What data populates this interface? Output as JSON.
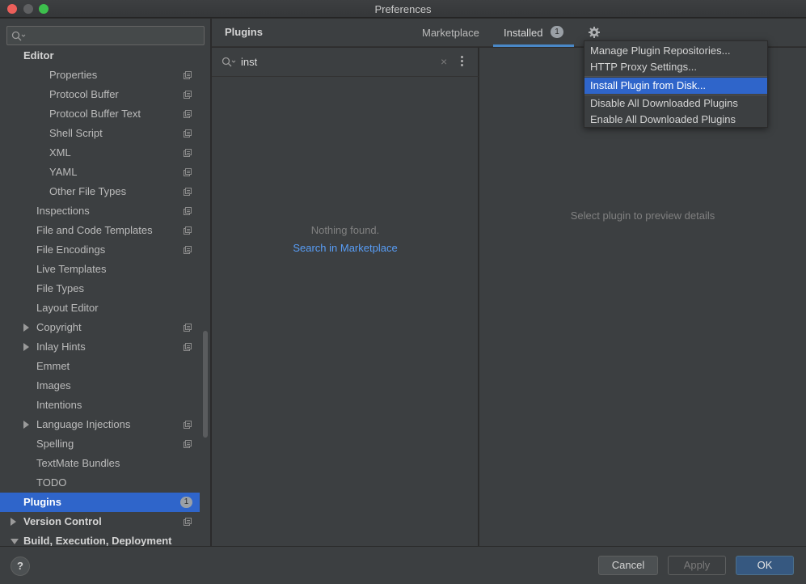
{
  "window": {
    "title": "Preferences"
  },
  "sidebar": {
    "search_placeholder": "",
    "items": [
      {
        "label": "Editor",
        "level": 0,
        "bold": true,
        "arrow": "none",
        "copy_icon": false,
        "badge": ""
      },
      {
        "label": "Properties",
        "level": 2,
        "bold": false,
        "arrow": "none",
        "copy_icon": true,
        "badge": ""
      },
      {
        "label": "Protocol Buffer",
        "level": 2,
        "bold": false,
        "arrow": "none",
        "copy_icon": true,
        "badge": ""
      },
      {
        "label": "Protocol Buffer Text",
        "level": 2,
        "bold": false,
        "arrow": "none",
        "copy_icon": true,
        "badge": ""
      },
      {
        "label": "Shell Script",
        "level": 2,
        "bold": false,
        "arrow": "none",
        "copy_icon": true,
        "badge": ""
      },
      {
        "label": "XML",
        "level": 2,
        "bold": false,
        "arrow": "none",
        "copy_icon": true,
        "badge": ""
      },
      {
        "label": "YAML",
        "level": 2,
        "bold": false,
        "arrow": "none",
        "copy_icon": true,
        "badge": ""
      },
      {
        "label": "Other File Types",
        "level": 2,
        "bold": false,
        "arrow": "none",
        "copy_icon": true,
        "badge": ""
      },
      {
        "label": "Inspections",
        "level": 1,
        "bold": false,
        "arrow": "none",
        "copy_icon": true,
        "badge": ""
      },
      {
        "label": "File and Code Templates",
        "level": 1,
        "bold": false,
        "arrow": "none",
        "copy_icon": true,
        "badge": ""
      },
      {
        "label": "File Encodings",
        "level": 1,
        "bold": false,
        "arrow": "none",
        "copy_icon": true,
        "badge": ""
      },
      {
        "label": "Live Templates",
        "level": 1,
        "bold": false,
        "arrow": "none",
        "copy_icon": false,
        "badge": ""
      },
      {
        "label": "File Types",
        "level": 1,
        "bold": false,
        "arrow": "none",
        "copy_icon": false,
        "badge": ""
      },
      {
        "label": "Layout Editor",
        "level": 1,
        "bold": false,
        "arrow": "none",
        "copy_icon": false,
        "badge": ""
      },
      {
        "label": "Copyright",
        "level": 1,
        "bold": false,
        "arrow": "right",
        "copy_icon": true,
        "badge": ""
      },
      {
        "label": "Inlay Hints",
        "level": 1,
        "bold": false,
        "arrow": "right",
        "copy_icon": true,
        "badge": ""
      },
      {
        "label": "Emmet",
        "level": 1,
        "bold": false,
        "arrow": "none",
        "copy_icon": false,
        "badge": ""
      },
      {
        "label": "Images",
        "level": 1,
        "bold": false,
        "arrow": "none",
        "copy_icon": false,
        "badge": ""
      },
      {
        "label": "Intentions",
        "level": 1,
        "bold": false,
        "arrow": "none",
        "copy_icon": false,
        "badge": ""
      },
      {
        "label": "Language Injections",
        "level": 1,
        "bold": false,
        "arrow": "right",
        "copy_icon": true,
        "badge": ""
      },
      {
        "label": "Spelling",
        "level": 1,
        "bold": false,
        "arrow": "none",
        "copy_icon": true,
        "badge": ""
      },
      {
        "label": "TextMate Bundles",
        "level": 1,
        "bold": false,
        "arrow": "none",
        "copy_icon": false,
        "badge": ""
      },
      {
        "label": "TODO",
        "level": 1,
        "bold": false,
        "arrow": "none",
        "copy_icon": false,
        "badge": ""
      },
      {
        "label": "Plugins",
        "level": 0,
        "bold": true,
        "arrow": "none",
        "copy_icon": false,
        "badge": "1",
        "selected": true
      },
      {
        "label": "Version Control",
        "level": 0,
        "bold": true,
        "arrow": "right",
        "copy_icon": true,
        "badge": ""
      },
      {
        "label": "Build, Execution, Deployment",
        "level": 0,
        "bold": true,
        "arrow": "down",
        "copy_icon": false,
        "badge": ""
      }
    ]
  },
  "header": {
    "title": "Plugins",
    "tabs": {
      "marketplace": "Marketplace",
      "installed": "Installed",
      "installed_badge": "1"
    }
  },
  "plugin_list": {
    "search_value": "inst",
    "clear_symbol": "×",
    "empty_text": "Nothing found.",
    "marketplace_link": "Search in Marketplace"
  },
  "detail": {
    "empty_text": "Select plugin to preview details"
  },
  "gear_menu": {
    "items": [
      "Manage Plugin Repositories...",
      "HTTP Proxy Settings...",
      "Install Plugin from Disk...",
      "Disable All Downloaded Plugins",
      "Enable All Downloaded Plugins"
    ],
    "highlighted_index": 2
  },
  "footer": {
    "help": "?",
    "cancel": "Cancel",
    "apply": "Apply",
    "ok": "OK"
  },
  "colors": {
    "accent": "#2f65ca",
    "link": "#589df6",
    "background": "#3c3f41"
  }
}
